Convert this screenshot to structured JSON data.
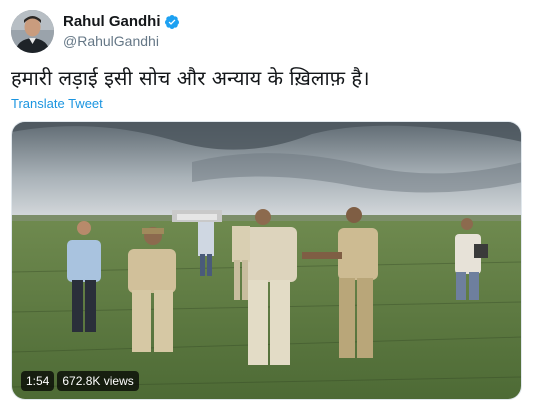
{
  "tweet": {
    "author": {
      "display_name": "Rahul Gandhi",
      "handle": "@RahulGandhi",
      "verified": true,
      "avatar_icon": "profile-photo"
    },
    "text": "हमारी लड़ाई इसी सोच और अन्याय के ख़िलाफ़ है।",
    "translate_label": "Translate Tweet",
    "video": {
      "duration": "1:54",
      "views": "672.8K views"
    }
  },
  "colors": {
    "link": "#1b95e0",
    "verified_badge": "#1da1f2",
    "secondary_text": "#657786"
  }
}
